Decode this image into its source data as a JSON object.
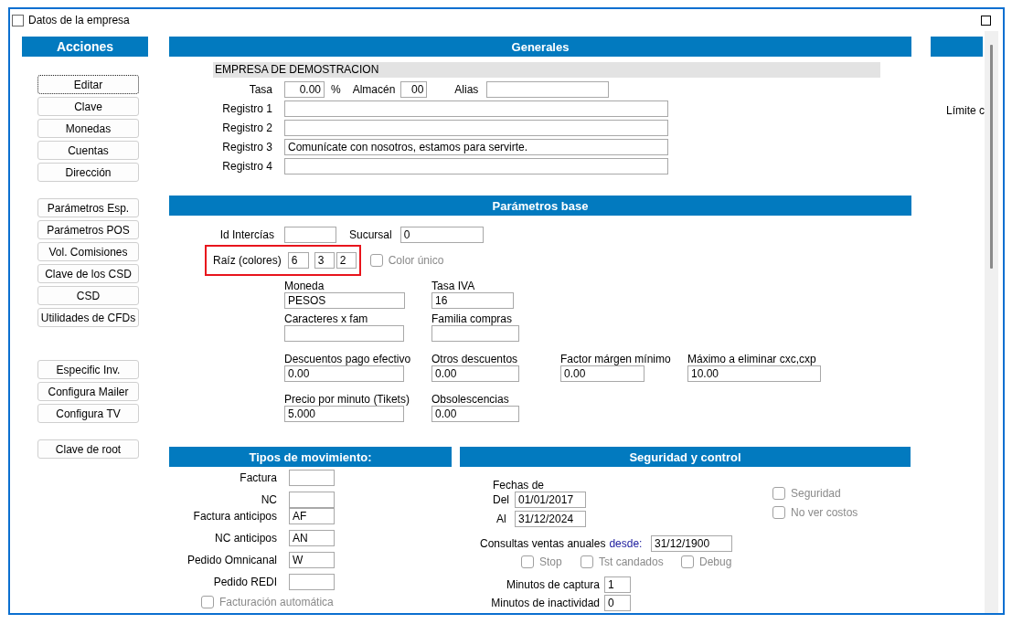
{
  "window": {
    "title": "Datos de la empresa"
  },
  "actions": {
    "title": "Acciones",
    "groups": [
      [
        {
          "label": "Editar",
          "focused": true
        },
        {
          "label": "Clave",
          "focused": false
        },
        {
          "label": "Monedas",
          "focused": false
        },
        {
          "label": "Cuentas",
          "focused": false
        },
        {
          "label": "Dirección",
          "focused": false
        }
      ],
      [
        {
          "label": "Parámetros Esp.",
          "focused": false
        },
        {
          "label": "Parámetros POS",
          "focused": false
        },
        {
          "label": "Vol. Comisiones",
          "focused": false
        },
        {
          "label": "Clave de los CSD",
          "focused": false
        },
        {
          "label": "CSD",
          "focused": false
        },
        {
          "label": "Utilidades de CFDs",
          "focused": false
        }
      ],
      [
        {
          "label": "Especific Inv.",
          "focused": false
        },
        {
          "label": "Configura Mailer",
          "focused": false
        },
        {
          "label": "Configura TV",
          "focused": false
        }
      ],
      [
        {
          "label": "Clave de root",
          "focused": false
        }
      ]
    ]
  },
  "generales": {
    "title": "Generales",
    "company_name": "EMPRESA DE DEMOSTRACION",
    "tasa": {
      "label": "Tasa",
      "value": "0.00",
      "unit": "%"
    },
    "almacen": {
      "label": "Almacén",
      "value": "00"
    },
    "alias": {
      "label": "Alias"
    },
    "registros": [
      {
        "label": "Registro 1"
      },
      {
        "label": "Registro 2"
      },
      {
        "label": "Registro 3",
        "value": "Comunícate con nosotros, estamos para servirte."
      },
      {
        "label": "Registro 4"
      }
    ]
  },
  "parametros_base": {
    "title": "Parámetros base",
    "id_intercias": {
      "label": "Id Intercías"
    },
    "sucursal": {
      "label": "Sucursal",
      "value": "0"
    },
    "raiz": {
      "label": "Raíz (colores)",
      "values": [
        "6",
        "3",
        "2"
      ],
      "highlighted": true
    },
    "color_unico": {
      "label": "Color único",
      "checked": false,
      "disabled": true
    },
    "fields": [
      [
        {
          "label": "Moneda",
          "value": "PESOS"
        },
        {
          "label": "Tasa IVA",
          "value": "16"
        }
      ],
      [
        {
          "label": "Caracteres x fam"
        },
        {
          "label": "Familia compras"
        }
      ],
      [
        {
          "label": "Descuentos pago efectivo",
          "value": "0.00"
        },
        {
          "label": "Otros descuentos",
          "value": "0.00"
        },
        {
          "label": "Factor márgen mínimo",
          "value": "0.00"
        },
        {
          "label": "Máximo a eliminar cxc,cxp",
          "value": "10.00"
        }
      ],
      [
        {
          "label": "Precio por minuto (Tikets)",
          "value": "5.000"
        },
        {
          "label": "Obsolescencias",
          "value": "0.00"
        }
      ]
    ]
  },
  "right_panel": {
    "label": "Límite c"
  },
  "tipos_movimiento": {
    "title": "Tipos de movimiento:",
    "rows": [
      {
        "label": "Factura"
      },
      {
        "label": "NC"
      },
      {
        "label": "Factura anticipos",
        "value": "AF"
      },
      {
        "label": "NC anticipos",
        "value": "AN"
      },
      {
        "label": "Pedido Omnicanal",
        "value": "W"
      },
      {
        "label": "Pedido REDI"
      }
    ],
    "facturacion": {
      "label": "Facturación automática",
      "checked": false,
      "disabled": true
    }
  },
  "seguridad": {
    "title": "Seguridad y control",
    "fechas_label": "Fechas de",
    "del": {
      "label": "Del",
      "value": "01/01/2017"
    },
    "al": {
      "label": "Al",
      "value": "31/12/2024"
    },
    "options": [
      {
        "label": "Seguridad",
        "checked": false,
        "disabled": true
      },
      {
        "label": "No ver costos",
        "checked": false,
        "disabled": true
      }
    ],
    "consultas": {
      "label": "Consultas ventas anuales",
      "link": "desde:",
      "value": "31/12/1900"
    },
    "flags": [
      {
        "label": "Stop",
        "checked": false,
        "disabled": true
      },
      {
        "label": "Tst candados",
        "checked": false,
        "disabled": true
      },
      {
        "label": "Debug",
        "checked": false,
        "disabled": true
      }
    ],
    "minutos": [
      {
        "label": "Minutos de captura",
        "value": "1"
      },
      {
        "label": "Minutos de inactividad",
        "value": "0"
      }
    ]
  }
}
